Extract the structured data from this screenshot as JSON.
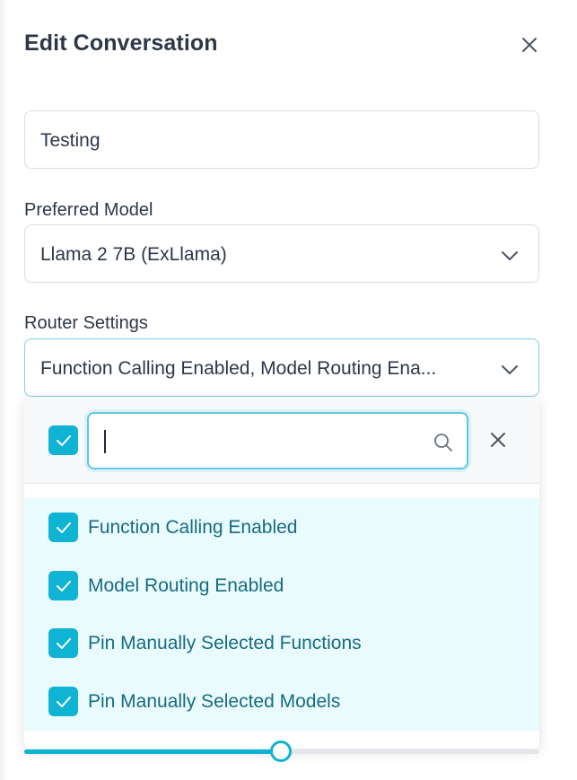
{
  "dialog": {
    "title": "Edit Conversation"
  },
  "conversation_name": {
    "value": "Testing"
  },
  "preferred_model": {
    "label": "Preferred Model",
    "selected": "Llama 2 7B (ExLlama)"
  },
  "router_settings": {
    "label": "Router Settings",
    "selected_summary": "Function Calling Enabled, Model Routing Ena...",
    "search_placeholder": "",
    "select_all_checked": true,
    "options": [
      {
        "label": "Function Calling Enabled",
        "checked": true
      },
      {
        "label": "Model Routing Enabled",
        "checked": true
      },
      {
        "label": "Pin Manually Selected Functions",
        "checked": true
      },
      {
        "label": "Pin Manually Selected Models",
        "checked": true
      }
    ]
  },
  "slider": {
    "value_fraction": 0.499
  },
  "colors": {
    "accent": "#0fb3d3",
    "option_text": "#176b82",
    "option_bg": "#e9fbfd",
    "title_text": "#2d3748"
  },
  "icons": {
    "close": "close-icon",
    "chevron": "chevron-down-icon",
    "search": "search-icon",
    "check": "check-icon"
  }
}
